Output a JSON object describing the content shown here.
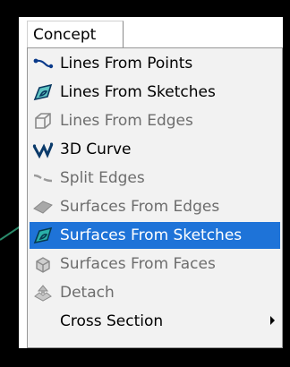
{
  "menu": {
    "title": "Concept",
    "items": [
      {
        "label": "Lines From Points",
        "icon": "lines-from-points-icon",
        "enabled": true
      },
      {
        "label": "Lines From Sketches",
        "icon": "lines-from-sketches-icon",
        "enabled": true
      },
      {
        "label": "Lines From Edges",
        "icon": "lines-from-edges-icon",
        "enabled": false
      },
      {
        "label": "3D Curve",
        "icon": "3d-curve-icon",
        "enabled": true
      },
      {
        "label": "Split Edges",
        "icon": "split-edges-icon",
        "enabled": false
      },
      {
        "label": "Surfaces From Edges",
        "icon": "surfaces-from-edges-icon",
        "enabled": false
      },
      {
        "label": "Surfaces From Sketches",
        "icon": "surfaces-from-sketches-icon",
        "enabled": true,
        "selected": true
      },
      {
        "label": "Surfaces From Faces",
        "icon": "surfaces-from-faces-icon",
        "enabled": false
      },
      {
        "label": "Detach",
        "icon": "detach-icon",
        "enabled": false
      },
      {
        "label": "Cross Section",
        "icon": "",
        "enabled": true,
        "submenu": true
      }
    ]
  },
  "colors": {
    "highlight": "#1e73d8",
    "icon_teal": "#0a8a8a",
    "menu_bg": "#f2f2f2",
    "frame": "#000000"
  }
}
